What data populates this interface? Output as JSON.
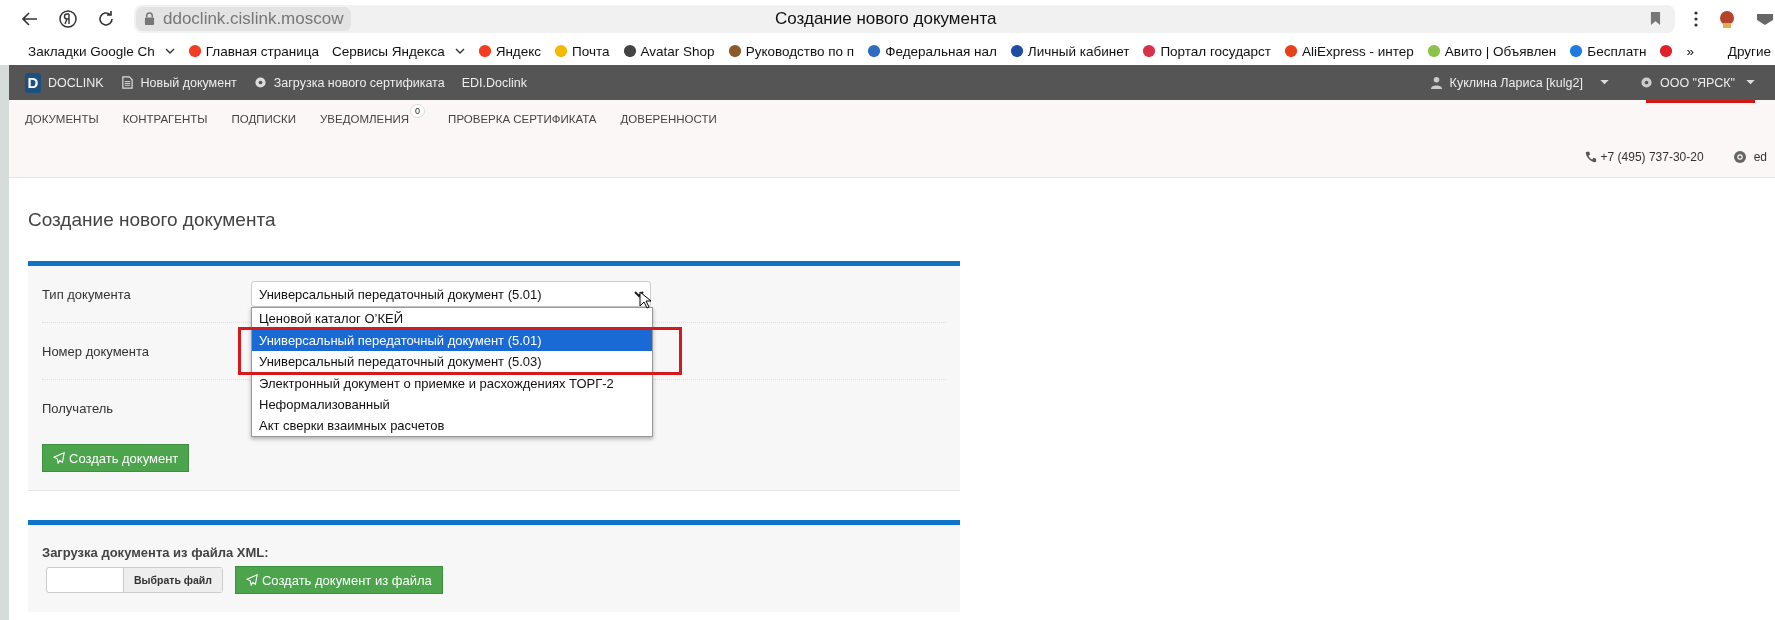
{
  "browser": {
    "url": "ddoclink.cislink.moscow",
    "tab_title": "Создание нового документа"
  },
  "bookmarks": [
    {
      "label": "Закладки Google Ch",
      "folder": true
    },
    {
      "label": "Главная страница",
      "color": "#f23d22",
      "folder": false
    },
    {
      "label": "Сервисы Яндекса",
      "folder": true
    },
    {
      "label": "Яндекс",
      "color": "#f23d22",
      "folder": false
    },
    {
      "label": "Почта",
      "color": "#f5b800",
      "folder": false
    },
    {
      "label": "Avatar Shop",
      "color": "#444444",
      "folder": false
    },
    {
      "label": "Руководство по п",
      "color": "#8a5a2b",
      "folder": false
    },
    {
      "label": "Федеральная нал",
      "color": "#2e6cc4",
      "folder": false
    },
    {
      "label": "Личный кабинет",
      "color": "#1c4fa0",
      "folder": false
    },
    {
      "label": "Портал государст",
      "color": "#d6334a",
      "folder": false
    },
    {
      "label": "AliExpress - интер",
      "color": "#e8401c",
      "folder": false
    },
    {
      "label": "Авито | Объявлен",
      "color": "#8bc34a",
      "folder": false
    },
    {
      "label": "Бесплатн",
      "color": "#1e7be0",
      "folder": false
    },
    {
      "color": "#e0202a",
      "folder": false
    }
  ],
  "bookmarks_more": "»",
  "bookmarks_other": "Другие",
  "topnav": {
    "logo_letter": "D",
    "logo_text": "DOCLINK",
    "links": [
      "Новый документ",
      "Загрузка нового сертификата",
      "EDI.Doclink"
    ],
    "user": "Куклина Лариса [kulg2]",
    "org": "ООО \"ЯРСК\"",
    "org_underlined": true
  },
  "menu": [
    {
      "label": "ДОКУМЕНТЫ"
    },
    {
      "label": "КОНТРАГЕНТЫ"
    },
    {
      "label": "ПОДПИСКИ"
    },
    {
      "label": "УВЕДОМЛЕНИЯ",
      "badge": "0"
    },
    {
      "label": "ПРОВЕРКА СЕРТИФИКАТА"
    },
    {
      "label": "ДОВЕРЕННОСТИ"
    }
  ],
  "contacts": {
    "phone": "+7 (495) 737-30-20",
    "email": "ed"
  },
  "page_title": "Создание нового документа",
  "form": {
    "fields": [
      "Тип документа",
      "Номер документа",
      "Получатель"
    ],
    "select_value": "Универсальный передаточный документ (5.01)",
    "options": [
      {
        "label": "Ценовой каталог О’КЕЙ",
        "selected": false,
        "highlighted": false
      },
      {
        "label": "Универсальный передаточный документ (5.01)",
        "selected": true,
        "highlighted": true
      },
      {
        "label": "Универсальный передаточный документ (5.03)",
        "selected": false,
        "highlighted": true
      },
      {
        "label": "Электронный документ о приемке и расхождениях ТОРГ-2",
        "selected": false,
        "highlighted": false
      },
      {
        "label": "Неформализованный",
        "selected": false,
        "highlighted": false
      },
      {
        "label": "Акт сверки взаимных расчетов",
        "selected": false,
        "highlighted": false
      }
    ],
    "submit": "Создать документ"
  },
  "upload": {
    "label": "Загрузка документа из файла XML:",
    "choose": "Выбрать файл",
    "submit": "Создать документ из файла"
  }
}
